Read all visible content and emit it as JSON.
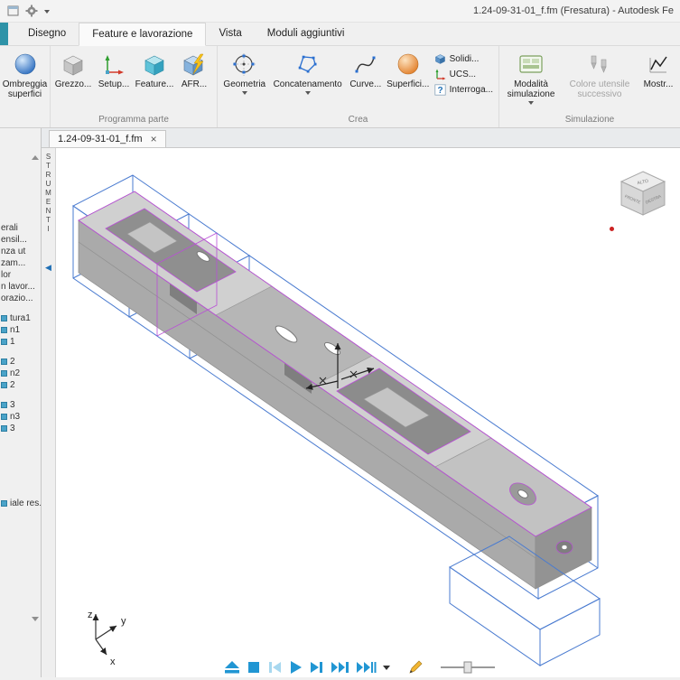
{
  "titlebar": {
    "title": "1.24-09-31-01_f.fm (Fresatura) - Autodesk Fe"
  },
  "tabs": [
    {
      "label": "Disegno"
    },
    {
      "label": "Feature e lavorazione"
    },
    {
      "label": "Vista"
    },
    {
      "label": "Moduli aggiuntivi"
    }
  ],
  "ribbon": {
    "groups": [
      {
        "label": "",
        "items": [
          {
            "label": "Ombreggia superfici"
          }
        ]
      },
      {
        "label": "Programma parte",
        "items": [
          {
            "label": "Grezzo..."
          },
          {
            "label": "Setup..."
          },
          {
            "label": "Feature..."
          },
          {
            "label": "AFR..."
          }
        ]
      },
      {
        "label": "Crea",
        "items": [
          {
            "label": "Geometria"
          },
          {
            "label": "Concatenamento"
          },
          {
            "label": "Curve..."
          },
          {
            "label": "Superfici..."
          },
          {
            "label": "Solidi..."
          },
          {
            "label": "UCS..."
          },
          {
            "label": "Interroga..."
          }
        ]
      },
      {
        "label": "Simulazione",
        "items": [
          {
            "label": "Modalità simulazione"
          },
          {
            "label": "Colore utensile successivo"
          },
          {
            "label": "Mostr..."
          }
        ]
      }
    ]
  },
  "document": {
    "tab_label": "1.24-09-31-01_f.fm",
    "close_glyph": "×"
  },
  "left_panel": {
    "strumenti": "STRUMENTI",
    "collapse_glyph": "◀",
    "tree_items": [
      "erali",
      "ensil...",
      "nza ut",
      "zam...",
      "lor",
      "n lavor...",
      "orazio...",
      "tura1",
      "n1",
      "1",
      "2",
      "n2",
      "2",
      "3",
      "n3",
      "3",
      "iale res..."
    ]
  },
  "viewcube": {
    "top": "ALTO",
    "front": "FRONTE",
    "right": "DESTRA"
  },
  "triad": {
    "x": "x",
    "y": "y",
    "z": "z"
  },
  "icons": {
    "quick_access": [
      "app-window-icon",
      "gear-icon",
      "chevron-down-icon"
    ],
    "playback": [
      "eject-button",
      "stop-button",
      "step-back-button",
      "play-button",
      "step-forward-button",
      "next-operation-button",
      "fast-forward-end-button",
      "options-chevron",
      "edit-pencil-button",
      "speed-slider"
    ]
  },
  "colors": {
    "wireframe_blue": "#4a7bd0",
    "wireframe_magenta": "#b94fd6",
    "playback_blue": "#2196d3",
    "accent_teal": "#2e93a8"
  }
}
